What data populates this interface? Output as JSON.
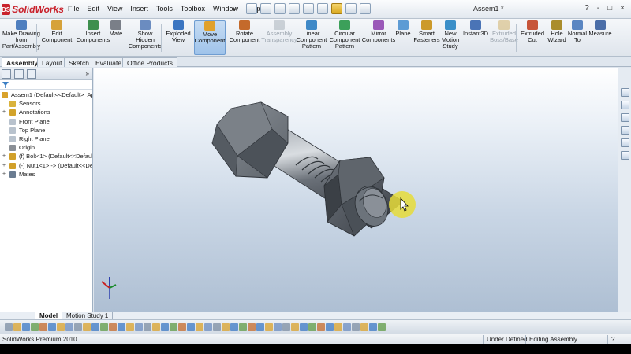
{
  "app": {
    "name": "SolidWorks",
    "menu": [
      "File",
      "Edit",
      "View",
      "Insert",
      "Tools",
      "Toolbox",
      "Window",
      "Help"
    ],
    "document_title": "Assem1 *",
    "window_buttons": [
      "?",
      "-",
      "□",
      "×"
    ]
  },
  "command_manager": {
    "commands": [
      {
        "label": "Make Drawing\nfrom\nPart/Assembly",
        "icon": "drawing-icon",
        "state": "normal"
      },
      {
        "label": "Edit\nComponent",
        "icon": "edit-component-icon",
        "state": "normal"
      },
      {
        "label": "Insert\nComponents",
        "icon": "insert-components-icon",
        "state": "normal"
      },
      {
        "label": "Mate",
        "icon": "mate-icon",
        "state": "normal"
      },
      {
        "label": "Show\nHidden\nComponents",
        "icon": "show-hidden-icon",
        "state": "normal"
      },
      {
        "label": "Exploded\nView",
        "icon": "exploded-view-icon",
        "state": "normal"
      },
      {
        "label": "Move\nComponent",
        "icon": "move-component-icon",
        "state": "active"
      },
      {
        "label": "Rotate\nComponent",
        "icon": "rotate-component-icon",
        "state": "normal"
      },
      {
        "label": "Assembly\nTransparency",
        "icon": "transparency-icon",
        "state": "disabled"
      },
      {
        "label": "Linear\nComponent\nPattern",
        "icon": "linear-pattern-icon",
        "state": "normal"
      },
      {
        "label": "Circular\nComponent\nPattern",
        "icon": "circular-pattern-icon",
        "state": "normal"
      },
      {
        "label": "Mirror\nComponents",
        "icon": "mirror-icon",
        "state": "normal"
      },
      {
        "label": "Plane",
        "icon": "plane-icon",
        "state": "normal"
      },
      {
        "label": "Smart\nFasteners",
        "icon": "smart-fasteners-icon",
        "state": "normal"
      },
      {
        "label": "New\nMotion\nStudy",
        "icon": "motion-study-icon",
        "state": "normal"
      },
      {
        "label": "Instant3D",
        "icon": "instant3d-icon",
        "state": "normal"
      },
      {
        "label": "Extruded\nBoss/Base",
        "icon": "extruded-boss-icon",
        "state": "disabled"
      },
      {
        "label": "Extruded\nCut",
        "icon": "extruded-cut-icon",
        "state": "normal"
      },
      {
        "label": "Hole\nWizard",
        "icon": "hole-wizard-icon",
        "state": "normal"
      },
      {
        "label": "Normal\nTo",
        "icon": "normal-to-icon",
        "state": "normal"
      },
      {
        "label": "Measure",
        "icon": "measure-icon",
        "state": "normal"
      }
    ]
  },
  "tabs": [
    "Assembly",
    "Layout",
    "Sketch",
    "Evaluate",
    "Office Products"
  ],
  "feature_tree": {
    "items": [
      {
        "label": "Assem1  (Default<<Default>_App",
        "icon": "assembly-icon",
        "indent": 0,
        "expander": ""
      },
      {
        "label": "Sensors",
        "icon": "sensors-icon",
        "indent": 1,
        "expander": ""
      },
      {
        "label": "Annotations",
        "icon": "annotations-icon",
        "indent": 1,
        "expander": "+"
      },
      {
        "label": "Front Plane",
        "icon": "plane-icon",
        "indent": 1,
        "expander": ""
      },
      {
        "label": "Top Plane",
        "icon": "plane-icon",
        "indent": 1,
        "expander": ""
      },
      {
        "label": "Right Plane",
        "icon": "plane-icon",
        "indent": 1,
        "expander": ""
      },
      {
        "label": "Origin",
        "icon": "origin-icon",
        "indent": 1,
        "expander": ""
      },
      {
        "label": "(f) Bolt<1> (Default<<Defaul",
        "icon": "part-icon",
        "indent": 1,
        "expander": "+"
      },
      {
        "label": "(-) Nut1<1> -> (Default<<De",
        "icon": "part-icon",
        "indent": 1,
        "expander": "+"
      },
      {
        "label": "Mates",
        "icon": "mates-icon",
        "indent": 1,
        "expander": "+"
      }
    ]
  },
  "bottom_tabs": [
    "Model",
    "Motion Study 1"
  ],
  "status": {
    "product": "SolidWorks Premium 2010",
    "definition": "Under Defined",
    "mode": "Editing Assembly",
    "help": "?"
  },
  "colors": {
    "accent": "#2c63aa",
    "cursor_highlight": "#e6dc3a",
    "model_gray": "#6b7179"
  }
}
